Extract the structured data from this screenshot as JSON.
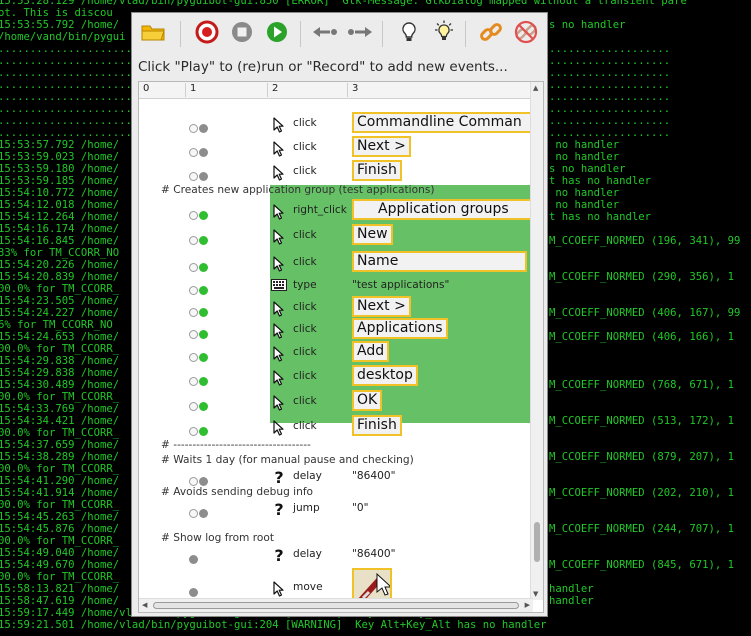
{
  "terminal": {
    "left_lines": [
      "15:53:28.129 /home/vlad/bin/pyguibot-gui:850 [ERROR]  Gtk-Message: GtkDialog mapped without a transient pare",
      "ot. This is discou",
      "15:53:55.792 /home/",
      "/home/vand/bin/pygui",
      "............................................",
      "............................................",
      "............................................",
      "............................................",
      "............................................",
      "............................................",
      "............................................",
      "............................................",
      "15:53:57.792 /home/",
      "15:53:59.023 /home/",
      "15:53:59.180 /home/",
      "15:53:59.185 /home/",
      "15:54:10.772 /home/",
      "15:54:12.018 /home/",
      "15:54:12.264 /home/",
      "15:54:16.174 /home/",
      "15:54:16.845 /home/",
      "33% for TM_CCORR_NO",
      "15:54:20.226 /home/",
      "15:54:20.839 /home/",
      "00.0% for TM_CCORR_",
      "15:54:23.505 /home/",
      "15:54:24.227 /home/",
      "6% for TM_CCORR_NO",
      "15:54:24.653 /home/",
      "00.0% for TM_CCORR_",
      "15:54:29.838 /home/",
      "15:54:29.838 /home/",
      "15:54:30.489 /home/",
      "00.0% for TM_CCORR_",
      "15:54:33.769 /home/",
      "15:54:34.421 /home/",
      "00.0% for TM_CCORR_",
      "15:54:37.659 /home/",
      "15:54:38.289 /home/",
      "00.0% for TM_CCORR_",
      "15:54:41.290 /home/",
      "15:54:41.914 /home/",
      "00.0% for TM_CCORR_",
      "15:54:45.263 /home/",
      "15:54:45.876 /home/",
      "00.0% for TM_CCORR_",
      "15:54:49.040 /home/",
      "15:54:49.670 /home/",
      "00.0% for TM_CCORR_",
      "15:58:13.821 /home/",
      "15:58:47.619 /home/",
      "15:59:17.449 /home/vlad/bin/pyguibot-gui:204 [WARNING]  Key Alt+Key_Alt has no handler",
      "15:59:21.501 /home/vlad/bin/pyguibot-gui:204 [WARNING]  Key Alt+Key_Alt has no handler"
    ],
    "right_lines": [
      {
        "row": 2,
        "col": 549,
        "text": "s no handler"
      },
      {
        "row": 4,
        "col": 549,
        "text": "..................."
      },
      {
        "row": 5,
        "col": 549,
        "text": "..................."
      },
      {
        "row": 6,
        "col": 549,
        "text": "..................."
      },
      {
        "row": 7,
        "col": 549,
        "text": "..................."
      },
      {
        "row": 8,
        "col": 549,
        "text": "..................."
      },
      {
        "row": 9,
        "col": 549,
        "text": "..................."
      },
      {
        "row": 10,
        "col": 549,
        "text": "..................."
      },
      {
        "row": 11,
        "col": 549,
        "text": "..................."
      },
      {
        "row": 12,
        "col": 549,
        "text": " no handler"
      },
      {
        "row": 13,
        "col": 549,
        "text": " no handler"
      },
      {
        "row": 14,
        "col": 549,
        "text": "s no handler"
      },
      {
        "row": 15,
        "col": 549,
        "text": "t has no handler"
      },
      {
        "row": 16,
        "col": 549,
        "text": " no handler"
      },
      {
        "row": 17,
        "col": 549,
        "text": " no handler"
      },
      {
        "row": 18,
        "col": 549,
        "text": "t has no handler"
      },
      {
        "row": 20,
        "col": 549,
        "text": "M_CCOEFF_NORMED (196, 341), 99"
      },
      {
        "row": 23,
        "col": 549,
        "text": "M_CCOEFF_NORMED (290, 356), 1"
      },
      {
        "row": 26,
        "col": 549,
        "text": "M_CCOEFF_NORMED (406, 167), 99"
      },
      {
        "row": 28,
        "col": 549,
        "text": "M_CCOEFF_NORMED (406, 166), 1"
      },
      {
        "row": 32,
        "col": 549,
        "text": "M_CCOEFF_NORMED (768, 671), 1"
      },
      {
        "row": 35,
        "col": 549,
        "text": "M_CCOEFF_NORMED (513, 172), 1"
      },
      {
        "row": 38,
        "col": 549,
        "text": "M_CCOEFF_NORMED (879, 207), 1"
      },
      {
        "row": 41,
        "col": 549,
        "text": "M_CCOEFF_NORMED (202, 210), 1"
      },
      {
        "row": 44,
        "col": 549,
        "text": "M_CCOEFF_NORMED (244, 707), 1"
      },
      {
        "row": 47,
        "col": 549,
        "text": "M_CCOEFF_NORMED (845, 671), 1"
      },
      {
        "row": 49,
        "col": 549,
        "text": "handler"
      },
      {
        "row": 50,
        "col": 549,
        "text": "handler"
      }
    ]
  },
  "window": {
    "hint": "Click \"Play\" to (re)run or \"Record\" to add new events...",
    "toolbar": [
      {
        "name": "open-folder-button",
        "icon": "folder-icon"
      },
      {
        "name": "record-button",
        "icon": "record-icon"
      },
      {
        "name": "stop-button",
        "icon": "stop-icon"
      },
      {
        "name": "play-button",
        "icon": "play-icon"
      },
      {
        "name": "step-back-button",
        "icon": "step-back-icon"
      },
      {
        "name": "step-forward-button",
        "icon": "step-forward-icon"
      },
      {
        "name": "hint-button",
        "icon": "bulb-icon"
      },
      {
        "name": "highlight-button",
        "icon": "bulb-rays-icon"
      },
      {
        "name": "link-button",
        "icon": "chain-link-icon"
      },
      {
        "name": "unlink-button",
        "icon": "chain-unlink-icon"
      }
    ],
    "columns": [
      "0",
      "1",
      "2",
      "3"
    ],
    "colors": {
      "accent_green": "#66c166",
      "image_border": "#f0c228",
      "terminal_text": "#21c728"
    }
  },
  "rows": [
    {
      "kind": "event",
      "dots": [
        "empty",
        "gray"
      ],
      "icon": "cursor-arrow-icon",
      "action": "click",
      "image": "Commandline Comman"
    },
    {
      "kind": "event",
      "dots": [
        "empty",
        "gray"
      ],
      "icon": "cursor-arrow-icon",
      "action": "click",
      "image": "Next >"
    },
    {
      "kind": "event",
      "dots": [
        "empty",
        "gray"
      ],
      "icon": "cursor-arrow-icon",
      "action": "click",
      "image": "Finish"
    },
    {
      "kind": "comment",
      "text": "# Creates new application group (test applications)"
    },
    {
      "kind": "event",
      "dots": [
        "empty",
        "green"
      ],
      "icon": "cursor-arrow-icon",
      "action": "right_click",
      "image": "Application groups"
    },
    {
      "kind": "event",
      "dots": [
        "empty",
        "green"
      ],
      "icon": "cursor-arrow-icon",
      "action": "click",
      "image": "New"
    },
    {
      "kind": "event",
      "dots": [
        "empty",
        "green"
      ],
      "icon": "cursor-arrow-icon",
      "action": "click",
      "image": "Name"
    },
    {
      "kind": "event",
      "dots": [
        "empty",
        "green"
      ],
      "icon": "keyboard-icon",
      "action": "type",
      "text": "\"test applications\""
    },
    {
      "kind": "event",
      "dots": [
        "empty",
        "green"
      ],
      "icon": "cursor-arrow-icon",
      "action": "click",
      "image": "Next >"
    },
    {
      "kind": "event",
      "dots": [
        "empty",
        "green"
      ],
      "icon": "cursor-arrow-icon",
      "action": "click",
      "image": "Applications"
    },
    {
      "kind": "event",
      "dots": [
        "empty",
        "green"
      ],
      "icon": "cursor-arrow-icon",
      "action": "click",
      "image": "Add"
    },
    {
      "kind": "event",
      "dots": [
        "empty",
        "green"
      ],
      "icon": "cursor-arrow-icon",
      "action": "click",
      "image": "desktop"
    },
    {
      "kind": "event",
      "dots": [
        "empty",
        "green"
      ],
      "icon": "cursor-arrow-icon",
      "action": "click",
      "image": "OK"
    },
    {
      "kind": "event",
      "dots": [
        "empty",
        "green"
      ],
      "icon": "cursor-arrow-icon",
      "action": "click",
      "image": "Finish"
    },
    {
      "kind": "comment",
      "text": "# ------------------------------------"
    },
    {
      "kind": "comment",
      "text": "# Waits 1 day (for manual pause and checking)"
    },
    {
      "kind": "event",
      "dots": [
        "empty",
        "gray"
      ],
      "icon": "question-icon",
      "action": "delay",
      "text": "\"86400\""
    },
    {
      "kind": "comment",
      "text": "# Avoids sending debug info"
    },
    {
      "kind": "event",
      "dots": [
        "empty",
        "gray"
      ],
      "icon": "question-icon",
      "action": "jump",
      "text": "\"0\""
    },
    {
      "kind": "comment",
      "text": "# Show log from root"
    },
    {
      "kind": "event",
      "dots": [
        "gray"
      ],
      "icon": "question-icon",
      "action": "delay",
      "text": "\"86400\""
    },
    {
      "kind": "event",
      "dots": [
        "gray"
      ],
      "icon": "cursor-arrow-icon",
      "action": "move",
      "image": "mouse-pointer-thumbnail"
    }
  ]
}
